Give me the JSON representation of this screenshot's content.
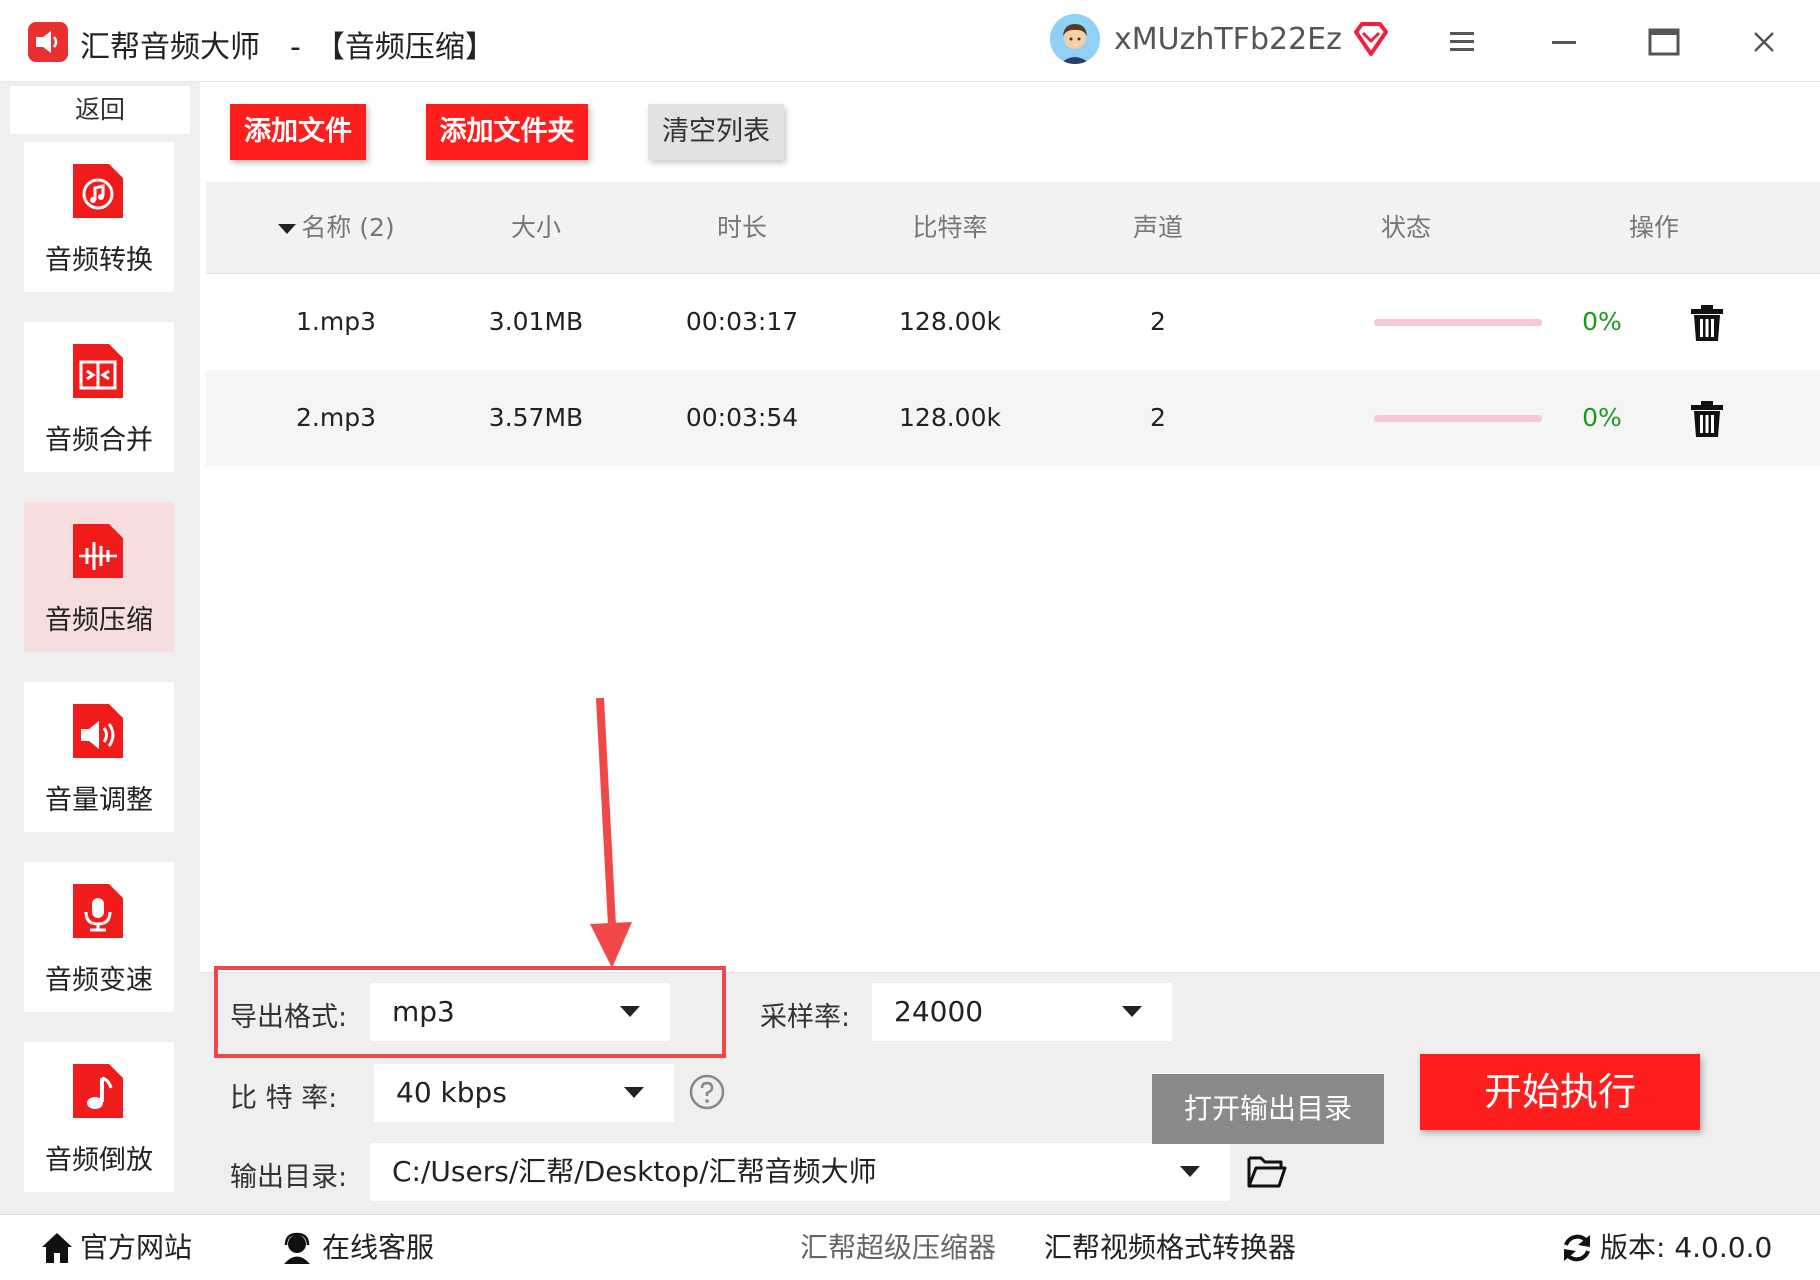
{
  "window": {
    "app_name": "汇帮音频大师",
    "separator": "-",
    "section_title": "【音频压缩】",
    "username": "xMUzhTFb22Ez",
    "icons": [
      "app-logo-icon",
      "avatar-icon",
      "vip-diamond-icon",
      "menu-icon",
      "minimize-icon",
      "maximize-icon",
      "close-icon"
    ]
  },
  "sidebar": {
    "back_label": "返回",
    "items": [
      {
        "label": "音频转换",
        "icon": "audio-convert-icon"
      },
      {
        "label": "音频合并",
        "icon": "audio-merge-icon"
      },
      {
        "label": "音频压缩",
        "icon": "audio-compress-icon",
        "active": true
      },
      {
        "label": "音量调整",
        "icon": "volume-adjust-icon"
      },
      {
        "label": "音频变速",
        "icon": "audio-speed-icon"
      },
      {
        "label": "音频倒放",
        "icon": "audio-reverse-icon"
      }
    ]
  },
  "toolbar": {
    "add_file": "添加文件",
    "add_folder": "添加文件夹",
    "clear_list": "清空列表"
  },
  "table": {
    "headers": {
      "name": "名称 (2)",
      "size": "大小",
      "duration": "时长",
      "bitrate": "比特率",
      "channels": "声道",
      "status": "状态",
      "action": "操作"
    },
    "rows": [
      {
        "name": "1.mp3",
        "size": "3.01MB",
        "duration": "00:03:17",
        "bitrate": "128.00k",
        "channels": "2",
        "progress": "0%"
      },
      {
        "name": "2.mp3",
        "size": "3.57MB",
        "duration": "00:03:54",
        "bitrate": "128.00k",
        "channels": "2",
        "progress": "0%"
      }
    ]
  },
  "settings": {
    "format_label": "导出格式:",
    "format_value": "mp3",
    "samplerate_label": "采样率:",
    "samplerate_value": "24000",
    "bitrate_label": "比 特 率:",
    "bitrate_value": "40 kbps",
    "output_label": "输出目录:",
    "output_value": "C:/Users/汇帮/Desktop/汇帮音频大师",
    "open_output": "打开输出目录",
    "start": "开始执行"
  },
  "footer": {
    "official_site": "官方网站",
    "online_service": "在线客服",
    "link_compressor": "汇帮超级压缩器",
    "link_video_converter": "汇帮视频格式转换器",
    "version": "版本:  4.0.0.0"
  },
  "colors": {
    "accent_red": "#ff1e1e",
    "annotation_red": "#f04848",
    "progress_pink": "#f7c7d3",
    "percent_green": "#1a9a1a",
    "active_nav_bg": "#f7dede"
  }
}
